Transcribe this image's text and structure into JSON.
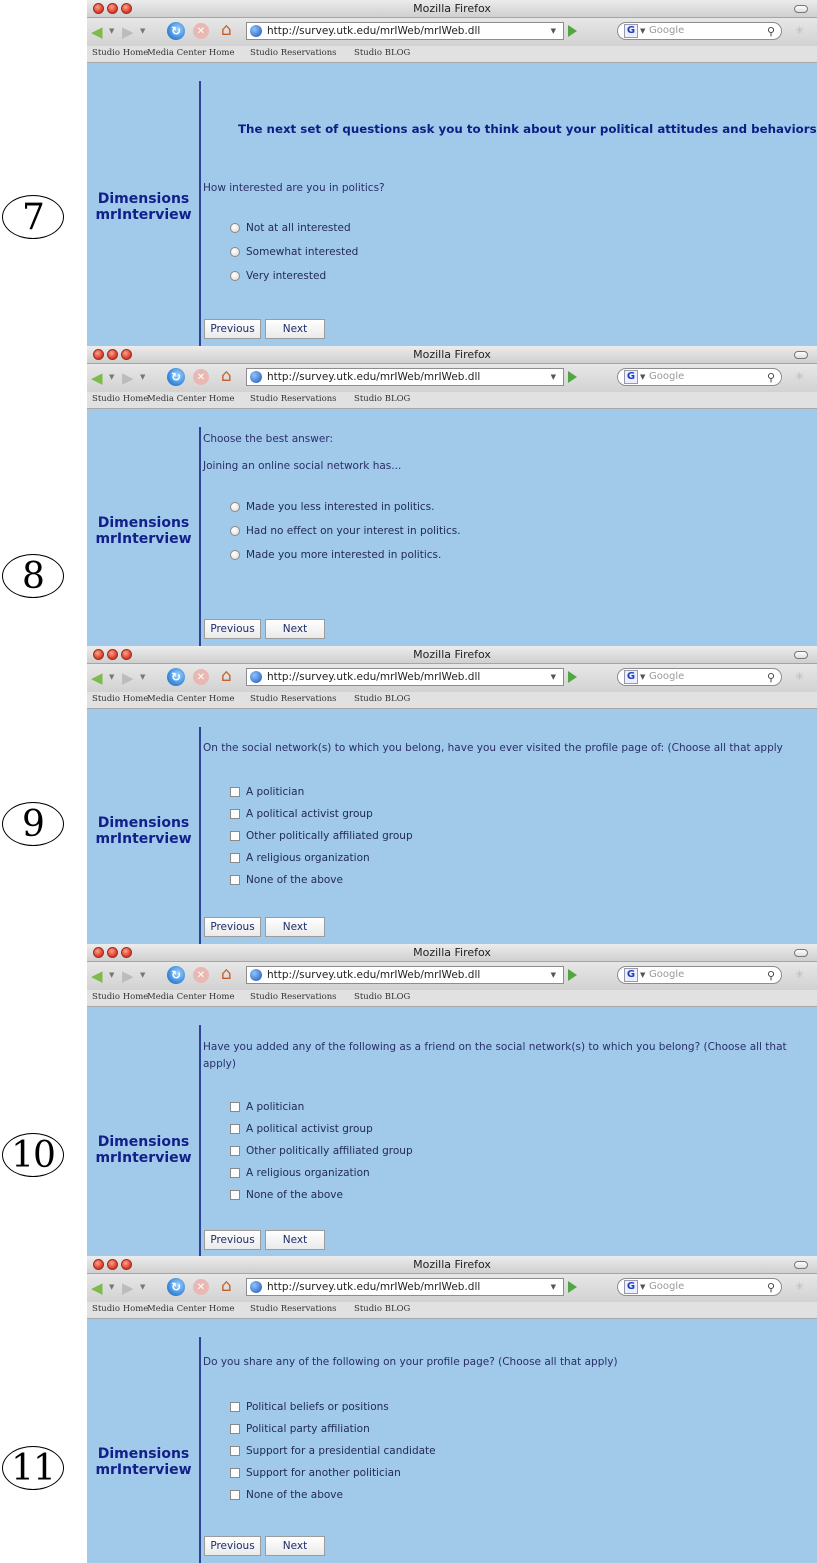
{
  "browser": {
    "window_title": "Mozilla Firefox",
    "url": "http://survey.utk.edu/mrIWeb/mrIWeb.dll",
    "search_placeholder": "Google",
    "bookmarks": [
      "Studio Home",
      "Media Center Home",
      "Studio Reservations",
      "Studio BLOG"
    ]
  },
  "logo": {
    "line1": "Dimensions",
    "line2": "mrInterview"
  },
  "buttons": {
    "previous": "Previous",
    "next": "Next"
  },
  "screens": [
    {
      "step": "7",
      "heading": "The next set of questions ask you to think about your political attitudes and behaviors.",
      "question": "How interested are you in politics?",
      "input_type": "radio",
      "options": [
        "Not at all interested",
        "Somewhat interested",
        "Very interested"
      ]
    },
    {
      "step": "8",
      "intro": "Choose the best answer:",
      "question": "Joining an online social network has...",
      "input_type": "radio",
      "options": [
        "Made you less interested in politics.",
        "Had no effect on your interest in politics.",
        "Made you more interested in politics."
      ]
    },
    {
      "step": "9",
      "question": "On the social network(s) to which you belong, have you ever visited the profile page of: (Choose all that apply",
      "input_type": "checkbox",
      "options": [
        "A politician",
        "A political activist group",
        "Other politically affiliated group",
        "A religious organization",
        "None of the above"
      ]
    },
    {
      "step": "10",
      "question": "Have you added any of the following as a friend on the social network(s) to which you belong? (Choose all that apply)",
      "input_type": "checkbox",
      "options": [
        "A politician",
        "A political activist group",
        "Other politically affiliated group",
        "A religious organization",
        "None of the above"
      ]
    },
    {
      "step": "11",
      "question": "Do you share any of the following on your profile page? (Choose all that apply)",
      "input_type": "checkbox",
      "options": [
        "Political beliefs or positions",
        "Political party affiliation",
        "Support for a presidential candidate",
        "Support for another politician",
        "None of the above"
      ]
    }
  ]
}
